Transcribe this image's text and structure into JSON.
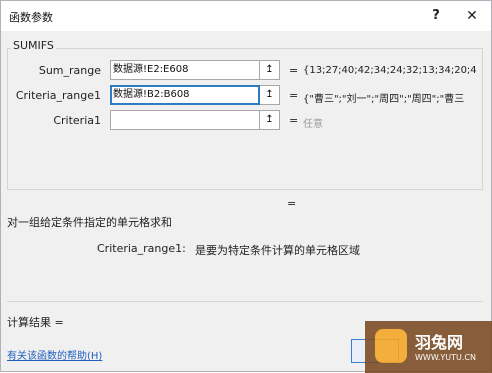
{
  "window": {
    "title": "函数参数",
    "help_label": "?",
    "close_label": "✕"
  },
  "function_name": "SUMIFS",
  "arguments": [
    {
      "label": "Sum_range",
      "value": "数据源!E2:E608",
      "result": "{13;27;40;42;34;24;32;13;34;20;4",
      "active": false
    },
    {
      "label": "Criteria_range1",
      "value": "数据源!B2:B608",
      "result": "{\"曹三\";\"刘一\";\"周四\";\"周四\";\"曹三",
      "active": true
    },
    {
      "label": "Criteria1",
      "value": "",
      "result": "任意",
      "active": false
    }
  ],
  "collapse_icon": "↥",
  "equals": "=",
  "description": "对一组给定条件指定的单元格求和",
  "argument_help": {
    "name": "Criteria_range1:",
    "text": "是要为特定条件计算的单元格区域"
  },
  "calc_result_label": "计算结果 =",
  "help_link": "有关该函数的帮助(H)",
  "watermark": {
    "title": "羽兔网",
    "url": "WWW.YUTU.CN"
  }
}
